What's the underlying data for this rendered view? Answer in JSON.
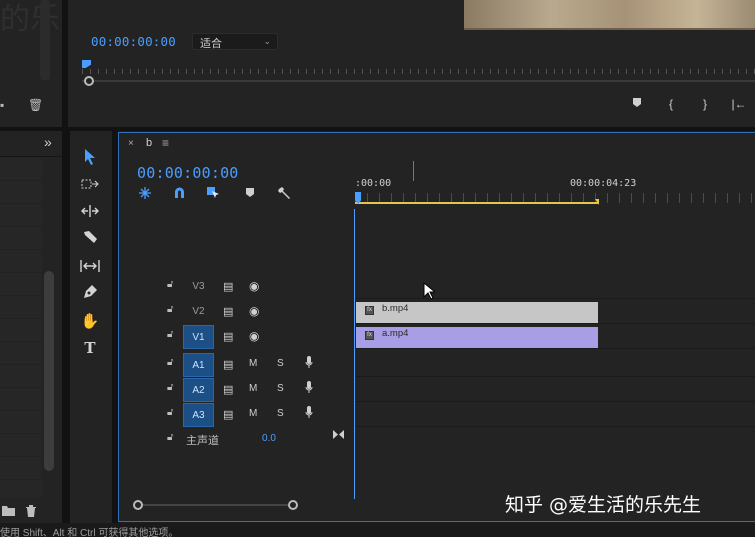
{
  "program_monitor": {
    "ghost_title": "的乐先生",
    "timecode": "00:00:00:00",
    "fit_select": "适合",
    "controls": [
      "marker-icon",
      "in-point-icon",
      "out-point-icon",
      "go-to-in-icon"
    ]
  },
  "project_panel": {
    "ghost_title": "的乐先生",
    "expand_glyph": "»"
  },
  "tools": [
    "selection-tool",
    "track-select-tool",
    "ripple-edit-tool",
    "razor-tool",
    "slip-tool",
    "pen-tool",
    "hand-tool",
    "type-tool"
  ],
  "timeline": {
    "tab_close": "×",
    "tab_name": "b",
    "tab_menu": "≡",
    "timecode": "00:00:00:00",
    "ruler_start": ":00:00",
    "ruler_end": "00:00:04:23",
    "tracks": [
      {
        "id": "V3",
        "kind": "video"
      },
      {
        "id": "V2",
        "kind": "video"
      },
      {
        "id": "V1",
        "kind": "video",
        "targeted": true
      },
      {
        "id": "A1",
        "kind": "audio",
        "targeted": true
      },
      {
        "id": "A2",
        "kind": "audio",
        "targeted": true
      },
      {
        "id": "A3",
        "kind": "audio",
        "targeted": true
      }
    ],
    "clips": {
      "v2": "b.mp4",
      "v1": "a.mp4"
    },
    "mute_label": "M",
    "solo_label": "S",
    "master": {
      "label": "主声道",
      "value": "0.0"
    }
  },
  "status_bar": "使用 Shift、Alt 和 Ctrl 可获得其他选项。",
  "watermark": "知乎 @爱生活的乐先生",
  "colors": {
    "accent": "#4a9eff",
    "video_clip": "#c6c6c6",
    "audio_clip": "#a89ee6",
    "work_area": "#e4c64a"
  }
}
